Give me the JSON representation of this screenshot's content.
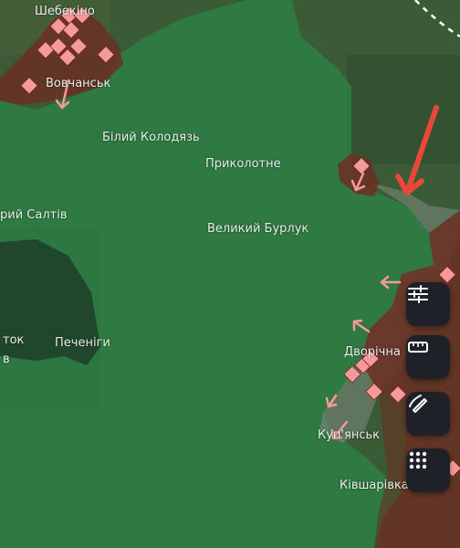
{
  "map": {
    "place_labels": [
      {
        "id": "shebekino",
        "text": "Шебекіно"
      },
      {
        "id": "vovchansk",
        "text": "Вовчанськ"
      },
      {
        "id": "bilyi-kolodiaz",
        "text": "Білий Колодязь"
      },
      {
        "id": "prykolotne",
        "text": "Приколотне"
      },
      {
        "id": "staryi-saltiv",
        "text": "рий Салтів"
      },
      {
        "id": "velykyi-burluk",
        "text": "Великий Бурлук"
      },
      {
        "id": "chuhuiv-fragment",
        "text": "ток"
      },
      {
        "id": "b-fragment",
        "text": "в"
      },
      {
        "id": "pechenihy",
        "text": "Печеніги"
      },
      {
        "id": "dvorichna",
        "text": "Дворічна"
      },
      {
        "id": "kupiansk",
        "text": "Куп'янськ"
      },
      {
        "id": "kivsharivka",
        "text": "Ківшарівка"
      }
    ]
  },
  "toolbar": {
    "buttons": [
      {
        "id": "filters",
        "icon": "sliders-icon",
        "label": ""
      },
      {
        "id": "measure",
        "icon": "ruler-icon",
        "label": ""
      },
      {
        "id": "draw",
        "icon": "draw-icon",
        "label": ""
      },
      {
        "id": "more",
        "icon": "grid-dots-icon",
        "label": ""
      }
    ]
  },
  "colors": {
    "friendly_area": "#2e7d46",
    "occupied_area": "#6b2f22",
    "contested_area": "#7f8d80",
    "attack_marker": "#f59a9a",
    "indicator_arrow": "#e8483a",
    "toolbar_bg": "#1e2128"
  }
}
